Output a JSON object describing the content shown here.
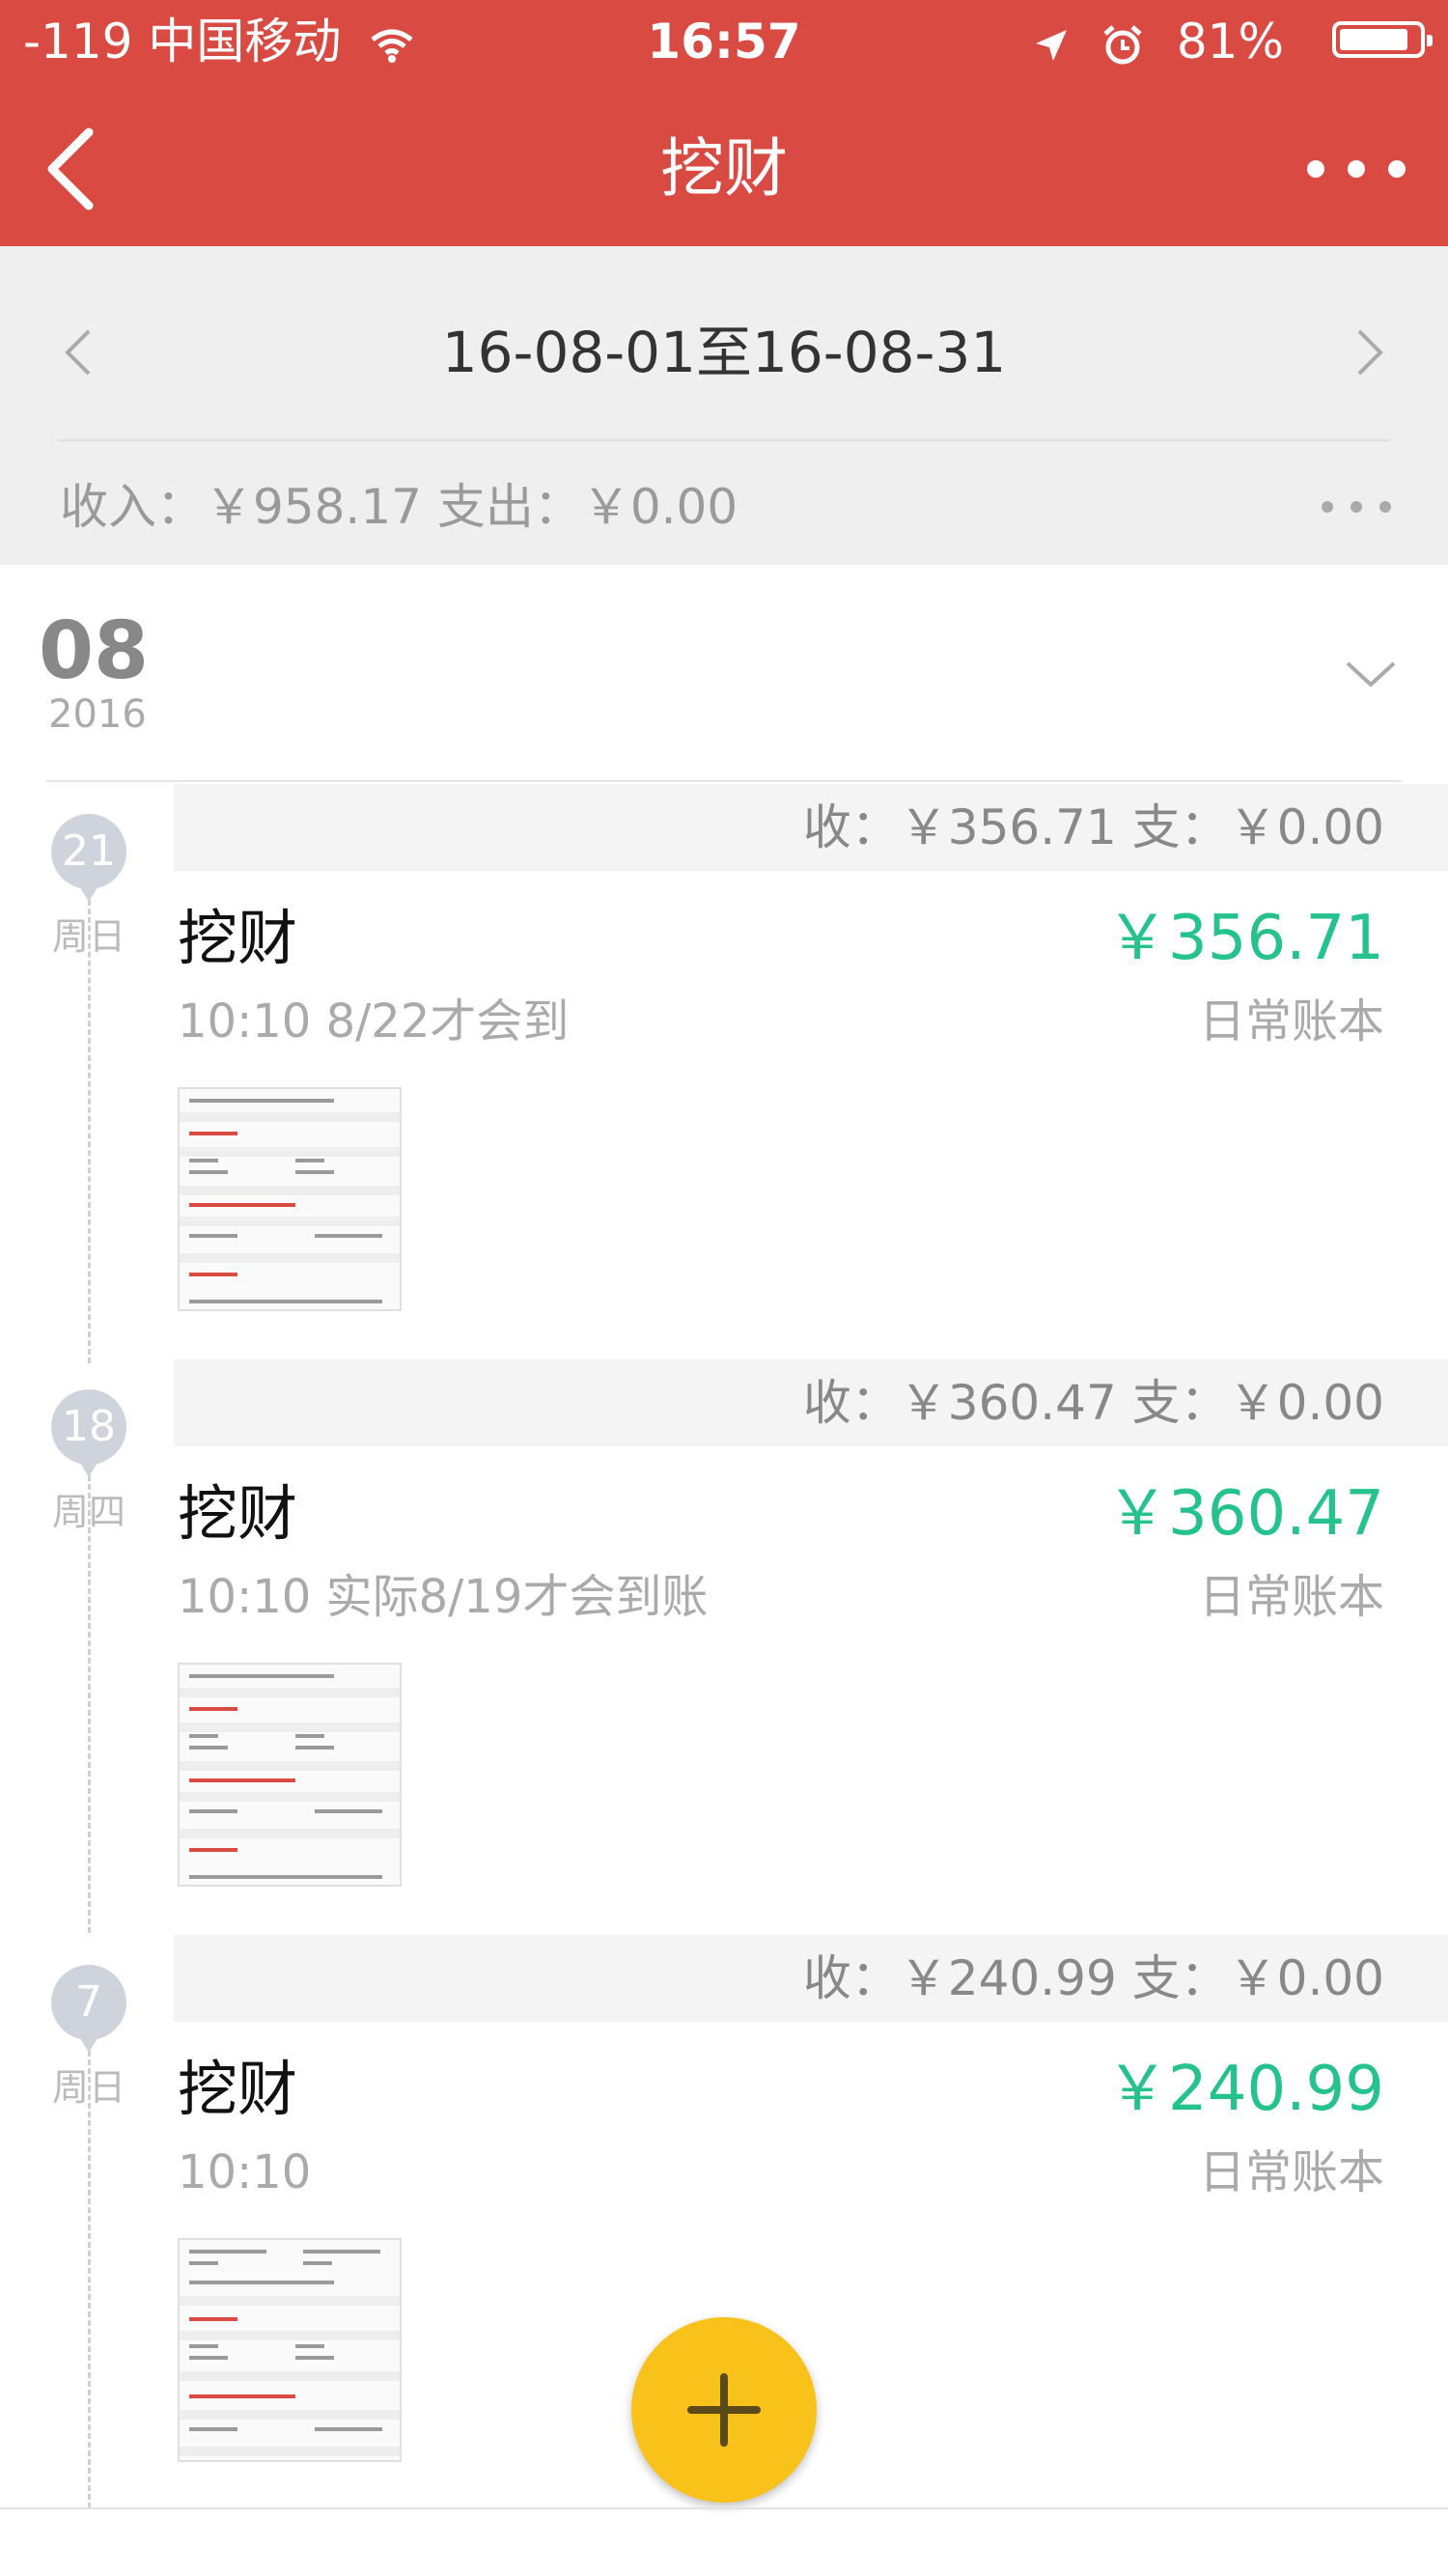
{
  "status_bar": {
    "carrier": "-119 中国移动",
    "time": "16:57",
    "battery": "81%",
    "icons": [
      "wifi-icon",
      "location-arrow-icon",
      "alarm-icon",
      "battery-icon"
    ]
  },
  "nav": {
    "title": "挖财",
    "back_icon": "chevron-left-icon",
    "more_icon": "more-dots-icon"
  },
  "range": {
    "text": "16-08-01至16-08-31",
    "summary": "收入：￥958.17  支出：￥0.00"
  },
  "month": {
    "num": "08",
    "year": "2016"
  },
  "days": [
    {
      "day": "21",
      "weekday": "周日",
      "summary": "收：￥356.71  支：￥0.00",
      "title": "挖财",
      "amount": "￥356.71",
      "note": "10:10 8/22才会到",
      "book": "日常账本"
    },
    {
      "day": "18",
      "weekday": "周四",
      "summary": "收：￥360.47  支：￥0.00",
      "title": "挖财",
      "amount": "￥360.47",
      "note": "10:10 实际8/19才会到账",
      "book": "日常账本"
    },
    {
      "day": "7",
      "weekday": "周日",
      "summary": "收：￥240.99  支：￥0.00",
      "title": "挖财",
      "amount": "￥240.99",
      "note": "10:10",
      "book": "日常账本"
    }
  ],
  "colors": {
    "header": "#d94a43",
    "income": "#25c28b",
    "fab": "#f9c21a"
  },
  "fab_icon": "plus-icon"
}
